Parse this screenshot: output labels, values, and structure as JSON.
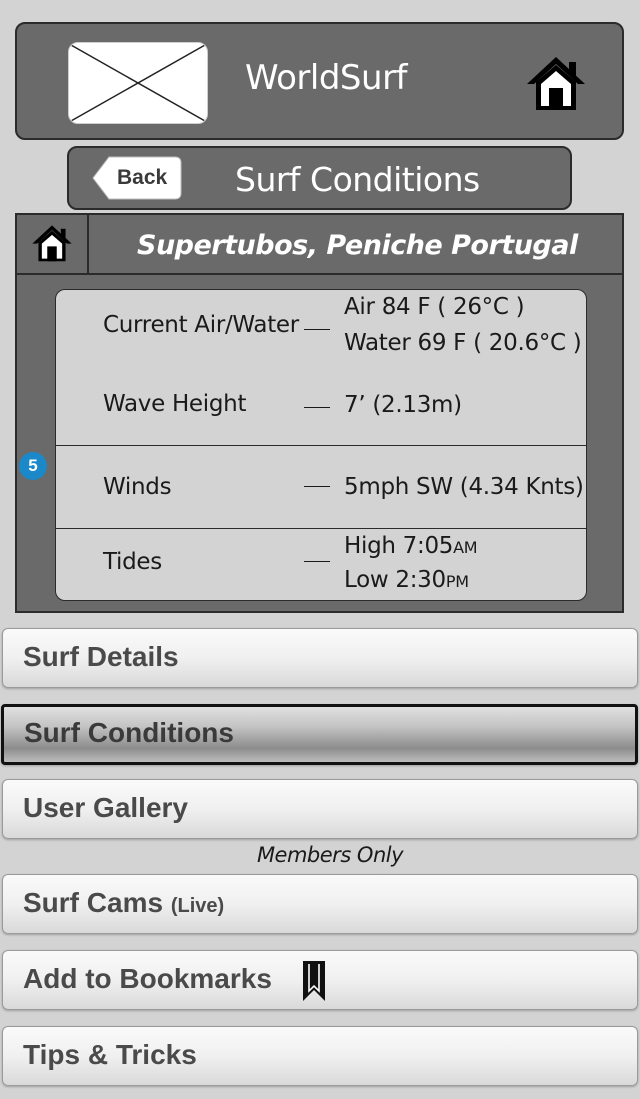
{
  "header": {
    "title": "WorldSurf",
    "logo_icon": "image-placeholder-icon",
    "home_icon": "home-icon"
  },
  "subheader": {
    "back_label": "Back",
    "title": "Surf Conditions"
  },
  "panel": {
    "location": "Supertubos, Peniche Portugal",
    "badge": "5",
    "conditions": {
      "air_water_label": "Current Air/Water",
      "air_value": "Air   84 F  ( 26°C )",
      "water_value": "Water 69 F ( 20.6°C )",
      "wave_label": "Wave Height",
      "wave_value": "7’  (2.13m)",
      "winds_label": "Winds",
      "winds_value": "5mph SW  (4.34 Knts)",
      "tides_label": "Tides",
      "tide_high": "High 7:05",
      "tide_high_suffix": "AM",
      "tide_low": "Low 2:30",
      "tide_low_suffix": "PM"
    }
  },
  "menu": {
    "surf_details": "Surf Details",
    "surf_conditions": "Surf Conditions",
    "user_gallery": "User Gallery",
    "members_only": "Members Only",
    "surf_cams": "Surf Cams",
    "surf_cams_tag": "(Live)",
    "add_bookmarks": "Add to Bookmarks",
    "tips_tricks": "Tips & Tricks"
  },
  "colors": {
    "background": "#d3d3d3",
    "header": "#6a6a6a",
    "badge": "#1a88c9"
  }
}
